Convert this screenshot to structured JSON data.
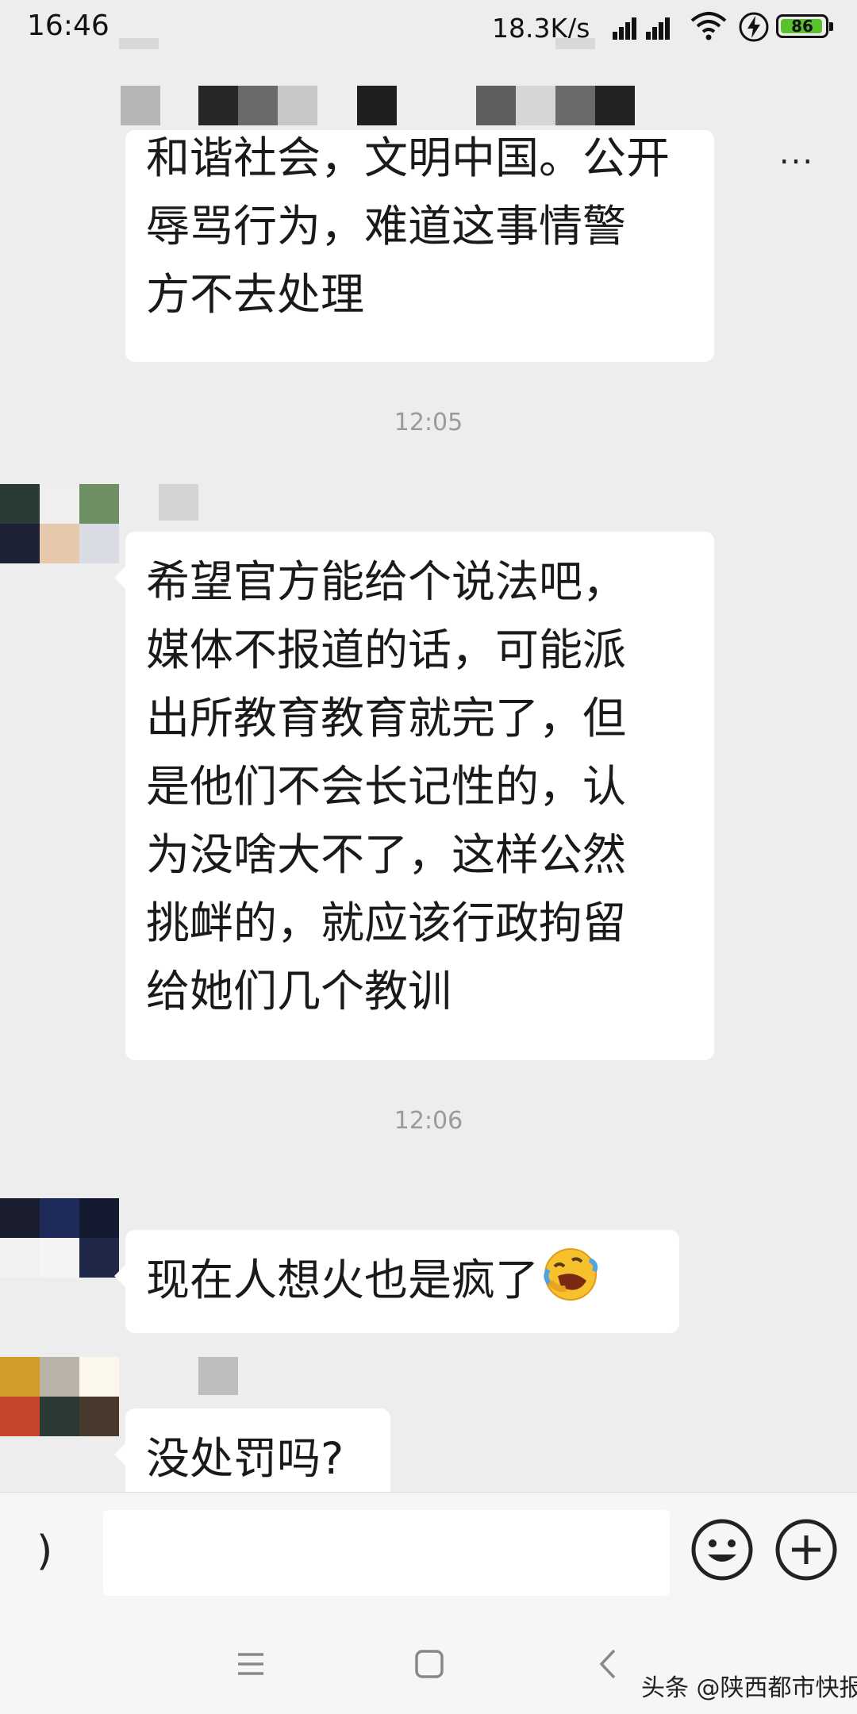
{
  "status_bar": {
    "time": "16:46",
    "net_speed": "18.3K/s",
    "battery": "86",
    "battery_color": "#5cc12e",
    "icons": [
      "signal-icon",
      "signal-icon",
      "wifi-icon",
      "charging-bolt-icon"
    ]
  },
  "title_bar": {
    "more_icon": "more-dots-icon",
    "more_label": "..."
  },
  "messages": [
    {
      "lines": [
        "和谐社会，文明中国。公开",
        "辱骂行为，难道这事情警",
        "方不去处理"
      ]
    },
    {
      "timestamp": "12:05",
      "lines": [
        "希望官方能给个说法吧，",
        "媒体不报道的话，可能派",
        "出所教育教育就完了，但",
        "是他们不会长记性的，认",
        "为没啥大不了，这样公然",
        "挑衅的，就应该行政拘留",
        "给她们几个教训"
      ]
    },
    {
      "timestamp": "12:06",
      "lines": [
        "现在人想火也是疯了"
      ],
      "emoji": "rolling-on-floor-laughing-emoji"
    },
    {
      "lines": [
        "没处罚吗?"
      ]
    }
  ],
  "input_bar": {
    "voice_icon": "voice-icon",
    "voice_glyph": ")",
    "emoji_icon": "emoji-icon",
    "plus_icon": "plus-icon"
  },
  "nav_bar": {
    "icons": [
      "menu-icon",
      "home-icon",
      "back-icon"
    ]
  },
  "watermark": "头条 @陕西都市快报"
}
